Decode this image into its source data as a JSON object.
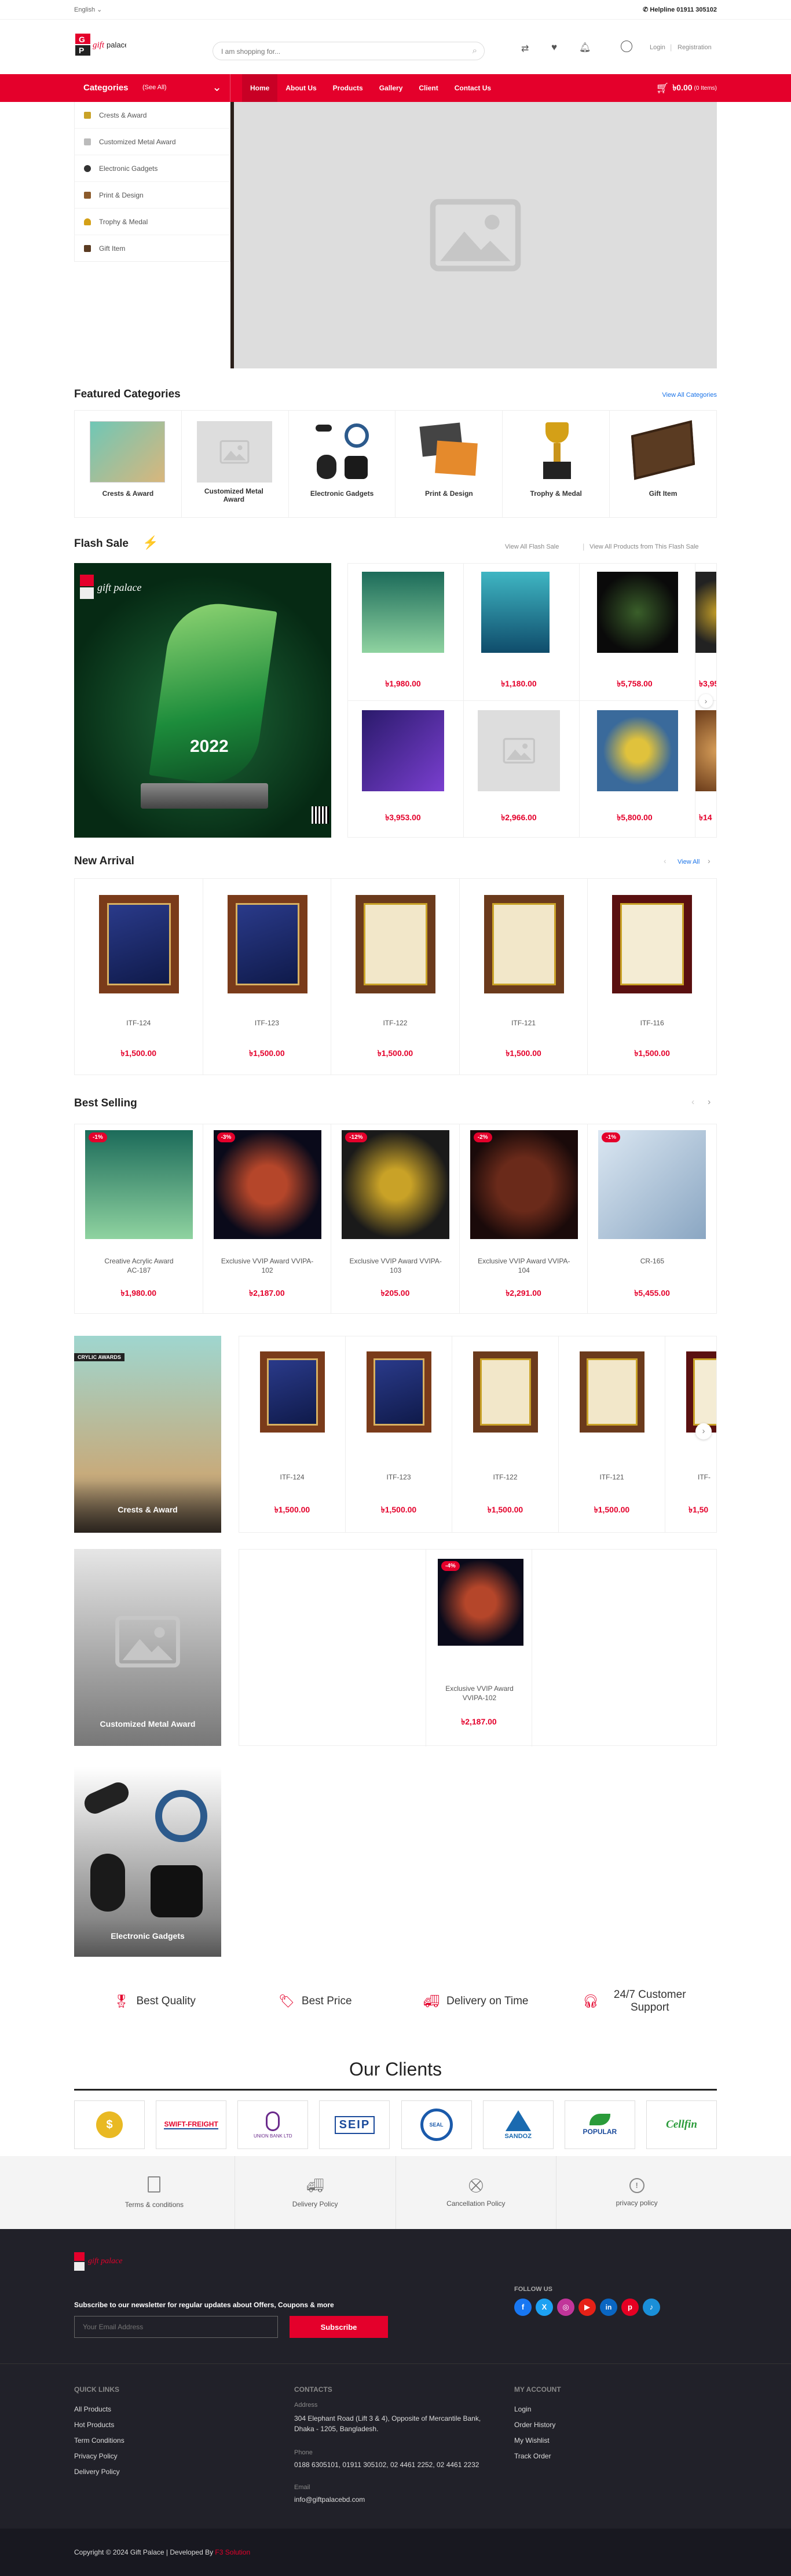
{
  "topbar": {
    "language": "English",
    "helpline": "Helpline 01911 305102"
  },
  "header": {
    "search_placeholder": "I am shopping for...",
    "login": "Login",
    "registration": "Registration"
  },
  "nav": {
    "categories_label": "Categories",
    "see_all": "(See All)",
    "links": [
      "Home",
      "About Us",
      "Products",
      "Gallery",
      "Client",
      "Contact Us"
    ],
    "cart_amount": "৳0.00",
    "cart_items": "(0 Items)"
  },
  "sidebar": {
    "items": [
      "Crests & Award",
      "Customized Metal Award",
      "Electronic Gadgets",
      "Print & Design",
      "Trophy & Medal",
      "Gift Item"
    ]
  },
  "featured": {
    "title": "Featured Categories",
    "view_all": "View All Categories",
    "items": [
      "Crests & Award",
      "Customized Metal Award",
      "Electronic Gadgets",
      "Print & Design",
      "Trophy & Medal",
      "Gift Item"
    ]
  },
  "flash": {
    "title": "Flash Sale",
    "view_all": "View All Flash Sale",
    "view_products": "View All Products from This Flash Sale",
    "banner_brand": "gift palace",
    "banner_year": "2022",
    "prices_row1": [
      "৳1,980.00",
      "৳1,180.00",
      "৳5,758.00",
      "৳3,95"
    ],
    "prices_row2": [
      "৳3,953.00",
      "৳2,966.00",
      "৳5,800.00",
      "৳14"
    ]
  },
  "new_arrival": {
    "title": "New Arrival",
    "view_all": "View All",
    "items": [
      {
        "name": "ITF-124",
        "price": "৳1,500.00"
      },
      {
        "name": "ITF-123",
        "price": "৳1,500.00"
      },
      {
        "name": "ITF-122",
        "price": "৳1,500.00"
      },
      {
        "name": "ITF-121",
        "price": "৳1,500.00"
      },
      {
        "name": "ITF-116",
        "price": "৳1,500.00"
      }
    ]
  },
  "best_selling": {
    "title": "Best Selling",
    "items": [
      {
        "badge": "-1%",
        "name": "Creative Acrylic Award AC-187",
        "price": "৳1,980.00"
      },
      {
        "badge": "-3%",
        "name": "Exclusive VVIP Award VVIPA-102",
        "price": "৳2,187.00"
      },
      {
        "badge": "-12%",
        "name": "Exclusive VVIP Award VVIPA-103",
        "price": "৳205.00"
      },
      {
        "badge": "-2%",
        "name": "Exclusive VVIP Award VVIPA-104",
        "price": "৳2,291.00"
      },
      {
        "badge": "-1%",
        "name": "CR-165",
        "price": "৳5,455.00"
      }
    ]
  },
  "category_blocks": {
    "crests": {
      "title": "Crests & Award",
      "banner_text": "CRYLIC AWARDS",
      "items": [
        {
          "name": "ITF-124",
          "price": "৳1,500.00"
        },
        {
          "name": "ITF-123",
          "price": "৳1,500.00"
        },
        {
          "name": "ITF-122",
          "price": "৳1,500.00"
        },
        {
          "name": "ITF-121",
          "price": "৳1,500.00"
        },
        {
          "name": "ITF-",
          "price": "৳1,50"
        }
      ]
    },
    "metal": {
      "title": "Customized Metal Award",
      "item": {
        "badge": "-4%",
        "name": "Exclusive VVIP Award VVIPA-102",
        "price": "৳2,187.00"
      }
    },
    "gadgets": {
      "title": "Electronic Gadgets"
    }
  },
  "features": [
    "Best Quality",
    "Best Price",
    "Delivery on Time",
    "24/7 Customer Support"
  ],
  "clients": {
    "title": "Our Clients",
    "logos": [
      "$",
      "SWIFT-FREIGHT",
      "UNION BANK LTD",
      "SEIP",
      "SEAL",
      "SANDOZ",
      "POPULAR",
      "Cellfin"
    ]
  },
  "policies": [
    "Terms & conditions",
    "Delivery Policy",
    "Cancellation Policy",
    "privacy policy"
  ],
  "footer": {
    "brand": "gift palace",
    "newsletter": "Subscribe to our newsletter for regular updates about Offers, Coupons & more",
    "email_placeholder": "Your Email Address",
    "subscribe": "Subscribe",
    "follow_us": "FOLLOW US",
    "quick_links_title": "QUICK LINKS",
    "quick_links": [
      "All Products",
      "Hot Products",
      "Term Conditions",
      "Privacy Policy",
      "Delivery Policy"
    ],
    "contacts_title": "CONTACTS",
    "address_label": "Address",
    "address": "304 Elephant Road (Lift 3 & 4), Opposite of Mercantile Bank, Dhaka - 1205, Bangladesh.",
    "phone_label": "Phone",
    "phone": "0188 6305101, 01911 305102, 02 4461 2252, 02 4461 2232",
    "email_label": "Email",
    "email": "info@giftpalacebd.com",
    "account_title": "MY ACCOUNT",
    "account_links": [
      "Login",
      "Order History",
      "My Wishlist",
      "Track Order"
    ],
    "copyright": "Copyright © 2024 Gift Palace | Developed By ",
    "developer": "F3 Solution"
  },
  "colors": {
    "primary": "#e4002b",
    "footer_bg": "#212129",
    "footer_bottom": "#181820"
  }
}
